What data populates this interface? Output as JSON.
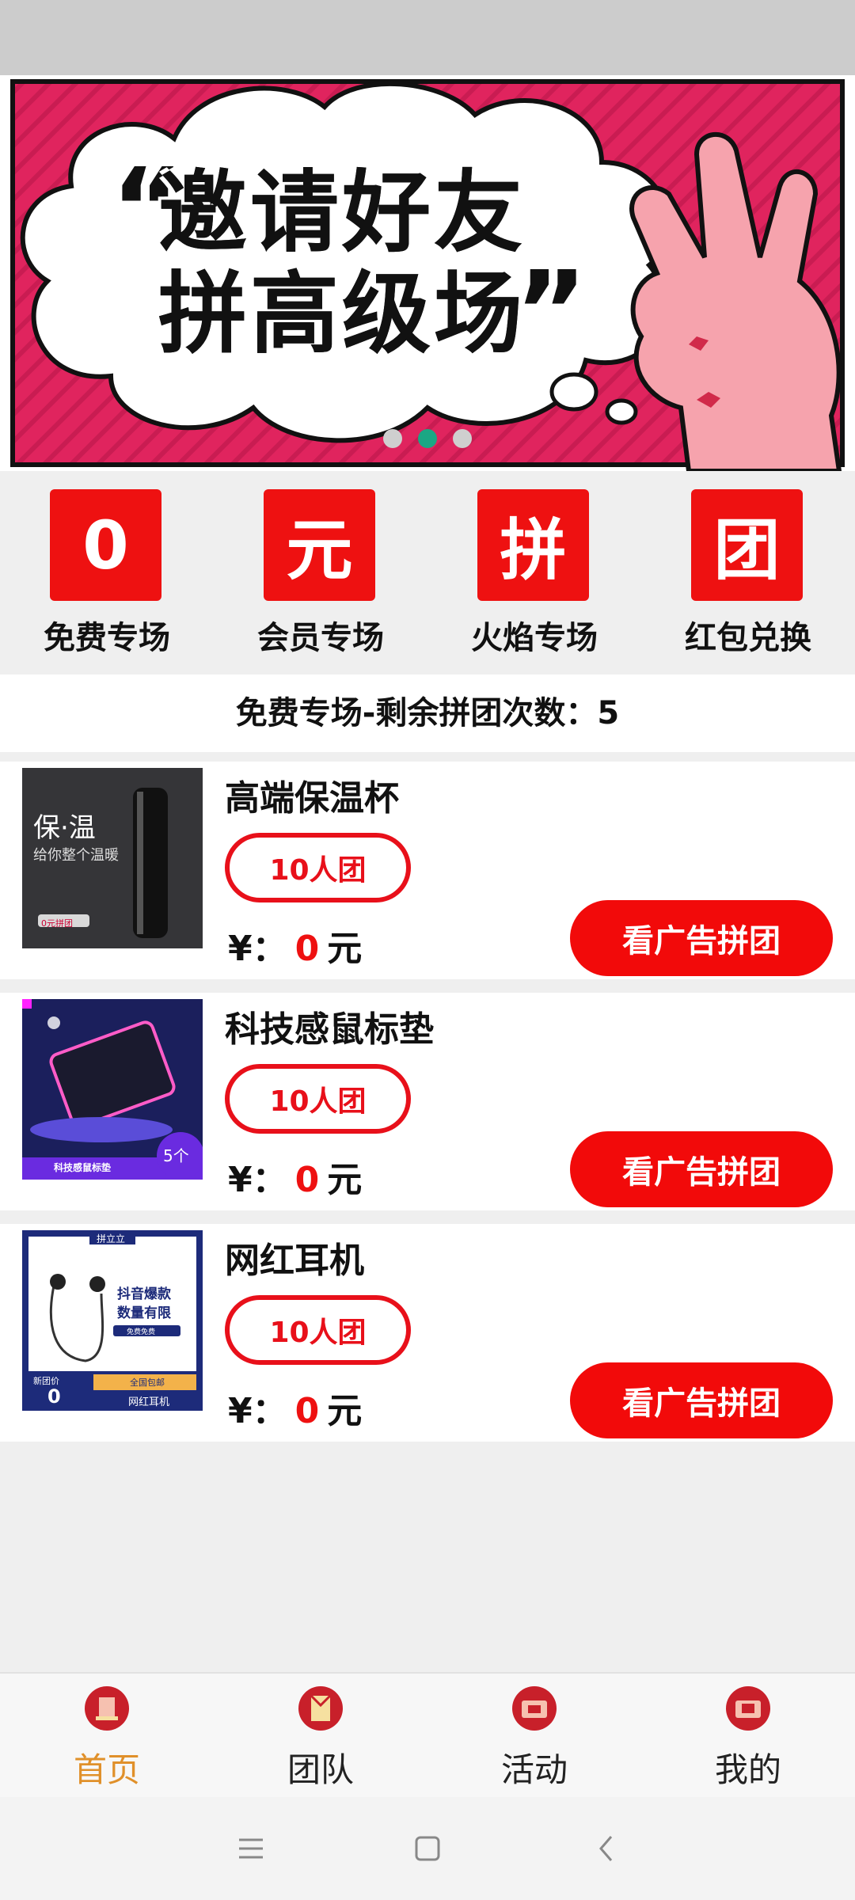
{
  "banner": {
    "line1": "邀请好友",
    "line2": "拼高级场",
    "open_quote": "“",
    "close_quote": "”",
    "colors": {
      "bg": "#e0245e",
      "border": "#111111"
    },
    "carousel": {
      "count": 3,
      "active": 2
    }
  },
  "categories": [
    {
      "tile": "0",
      "label": "免费专场"
    },
    {
      "tile": "元",
      "label": "会员专场"
    },
    {
      "tile": "拼",
      "label": "火焰专场"
    },
    {
      "tile": "团",
      "label": "红包兑换"
    }
  ],
  "remaining_text": "免费专场-剩余拼团次数：5",
  "products": [
    {
      "name": "高端保温杯",
      "group": "10人团",
      "currency": "¥：",
      "price": "0",
      "unit": "元",
      "cta": "看广告拼团",
      "thumb": {
        "title": "保·温",
        "subtitle": "给你整个温暖",
        "tag": "0元拼团"
      }
    },
    {
      "name": "科技感鼠标垫",
      "group": "10人团",
      "currency": "¥：",
      "price": "0",
      "unit": "元",
      "cta": "看广告拼团",
      "thumb": {
        "caption": "科技感鼠标垫",
        "count": "5个"
      }
    },
    {
      "name": "网红耳机",
      "group": "10人团",
      "currency": "¥：",
      "price": "0",
      "unit": "元",
      "cta": "看广告拼团",
      "thumb": {
        "brand": "拼立立",
        "headline1": "抖音爆款",
        "headline2": "数量有限",
        "button": "免费免费",
        "label1": "新团价",
        "label2": "全国包邮",
        "price": "0",
        "name": "网红耳机"
      }
    }
  ],
  "tabs": [
    {
      "label": "首页",
      "icon": "home-icon",
      "active": true
    },
    {
      "label": "团队",
      "icon": "team-icon",
      "active": false
    },
    {
      "label": "活动",
      "icon": "activity-icon",
      "active": false
    },
    {
      "label": "我的",
      "icon": "profile-icon",
      "active": false
    }
  ],
  "nav": {
    "menu": "menu-icon",
    "home": "square-home-icon",
    "back": "back-chevron-icon"
  },
  "colors": {
    "accent_red": "#ee1111",
    "tab_active": "#e0902a",
    "carousel_active": "#1ba784"
  }
}
